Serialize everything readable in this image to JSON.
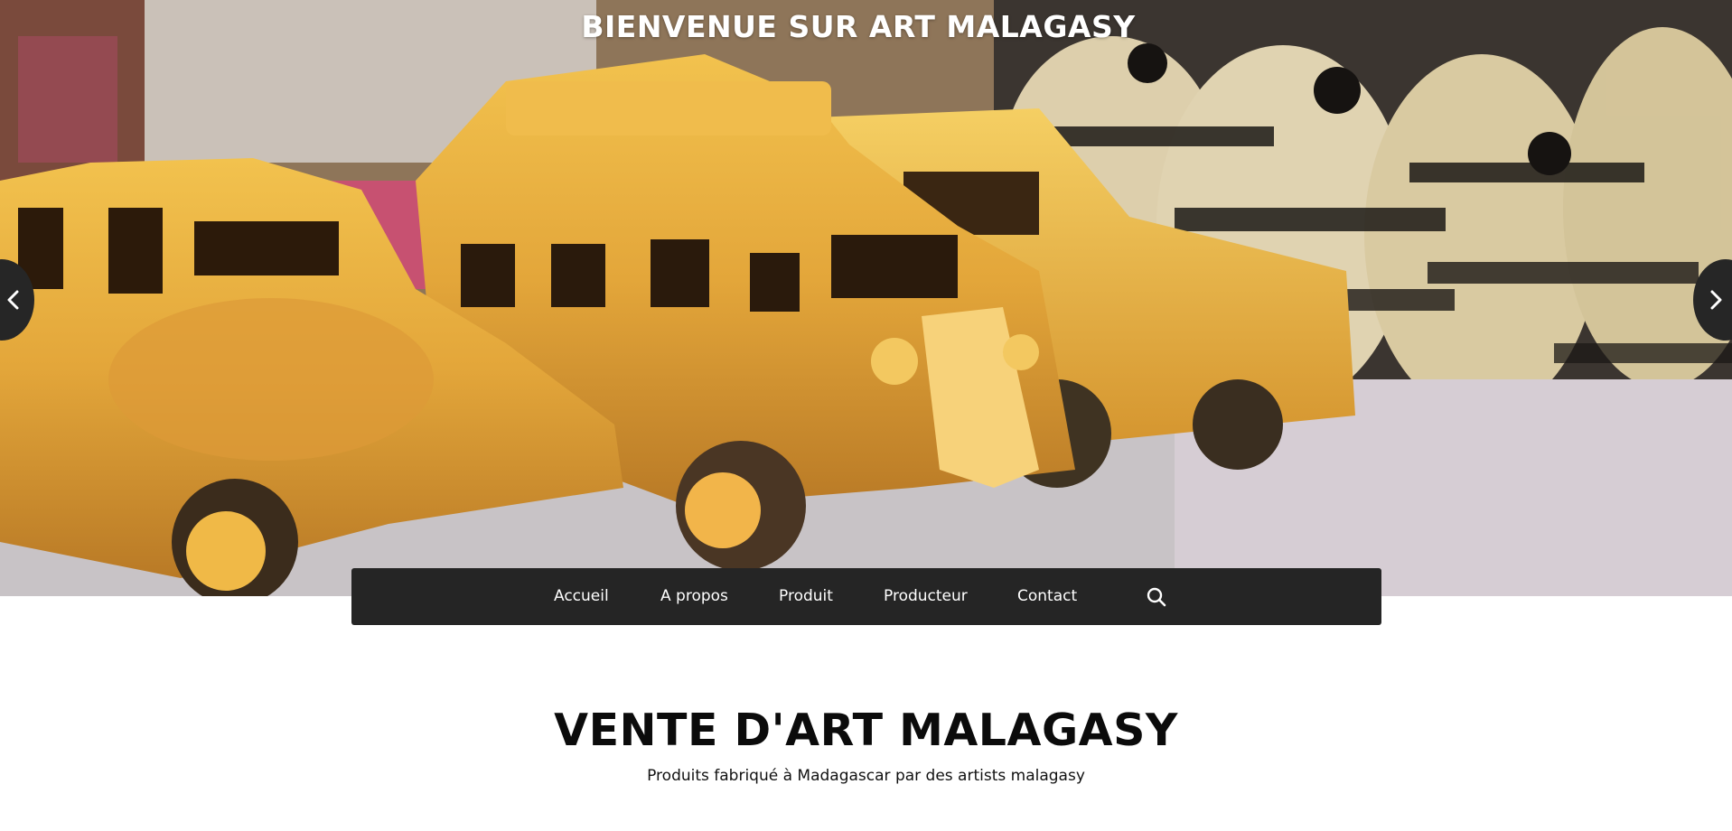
{
  "hero": {
    "title": "BIENVENUE SUR ART MALAGASY",
    "prev_icon": "chevron-left-icon",
    "next_icon": "chevron-right-icon"
  },
  "nav": {
    "items": [
      {
        "label": "Accueil"
      },
      {
        "label": "A propos"
      },
      {
        "label": "Produit"
      },
      {
        "label": "Producteur"
      },
      {
        "label": "Contact"
      }
    ],
    "search_icon": "search-icon",
    "background": "#252525"
  },
  "section": {
    "title": "VENTE D'ART MALAGASY",
    "subtitle": "Produits fabriqué à Madagascar par des artists malagasy"
  },
  "colors": {
    "nav_bg": "#252525",
    "text_dark": "#0b0b0b",
    "hero_text": "#ffffff"
  }
}
